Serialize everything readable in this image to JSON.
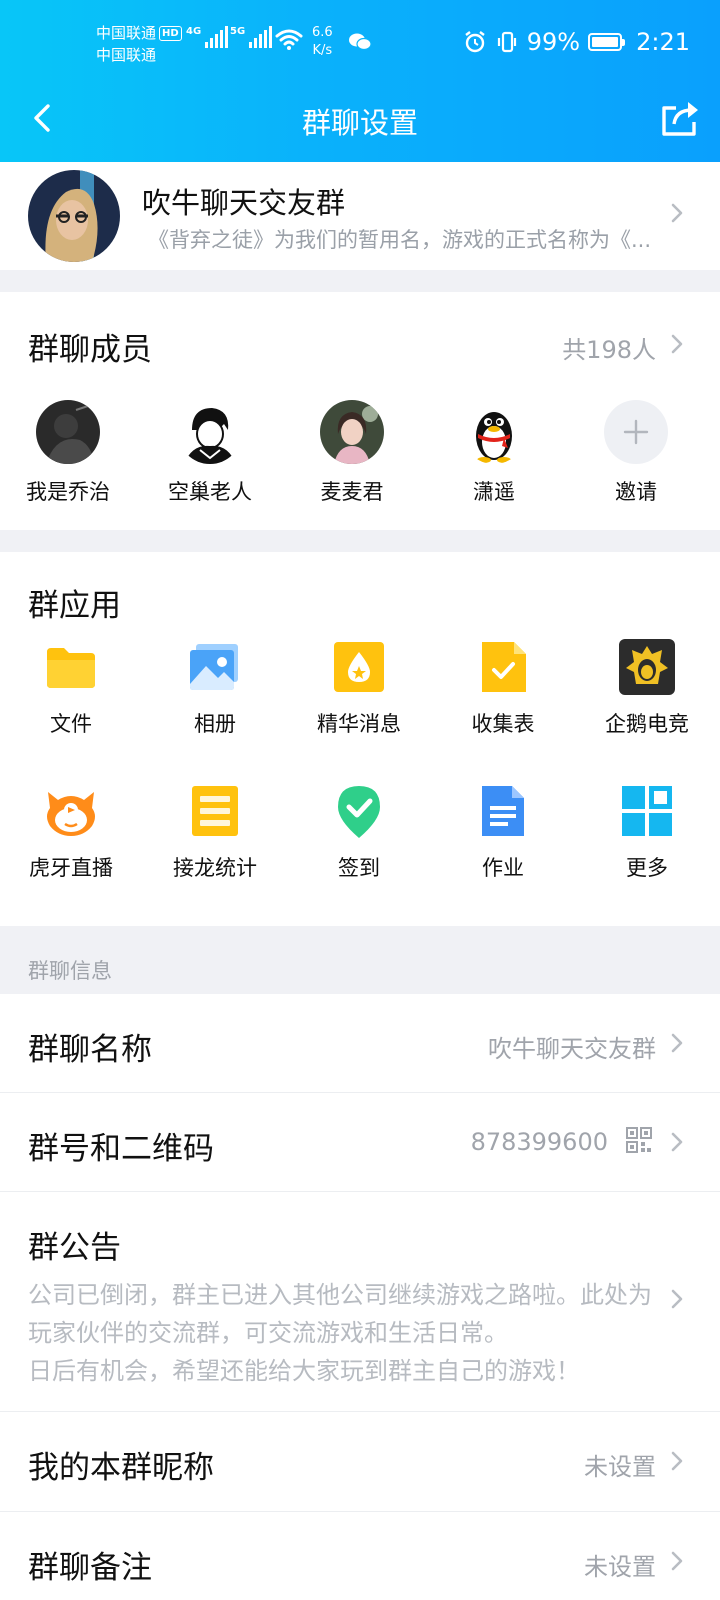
{
  "status_bar": {
    "carrier1": "中国联通",
    "carrier2": "中国联通",
    "hd": "HD",
    "net1": "4G",
    "net2": "5G",
    "speed_value": "6.6",
    "speed_unit": "K/s",
    "battery": "99%",
    "time": "2:21"
  },
  "header": {
    "title": "群聊设置"
  },
  "group": {
    "name": "吹牛聊天交友群",
    "description": "《背弃之徒》为我们的暂用名，游戏的正式名称为《..."
  },
  "members": {
    "title": "群聊成员",
    "count": "共198人",
    "list": [
      {
        "name": "我是乔治"
      },
      {
        "name": "空巢老人"
      },
      {
        "name": "麦麦君"
      },
      {
        "name": "潇遥"
      },
      {
        "name": "邀请"
      }
    ]
  },
  "apps": {
    "title": "群应用",
    "items": [
      {
        "label": "文件",
        "icon": "folder-icon"
      },
      {
        "label": "相册",
        "icon": "album-icon"
      },
      {
        "label": "精华消息",
        "icon": "essence-icon"
      },
      {
        "label": "收集表",
        "icon": "form-icon"
      },
      {
        "label": "企鹅电竞",
        "icon": "esports-icon"
      },
      {
        "label": "虎牙直播",
        "icon": "huya-icon"
      },
      {
        "label": "接龙统计",
        "icon": "list-icon"
      },
      {
        "label": "签到",
        "icon": "checkin-icon"
      },
      {
        "label": "作业",
        "icon": "homework-icon"
      },
      {
        "label": "更多",
        "icon": "more-grid-icon"
      }
    ]
  },
  "info": {
    "section_label": "群聊信息",
    "group_name_label": "群聊名称",
    "group_name_value": "吹牛聊天交友群",
    "group_id_label": "群号和二维码",
    "group_id_value": "878399600",
    "notice_label": "群公告",
    "notice_text": "公司已倒闭，群主已进入其他公司继续游戏之路啦。此处为玩家伙伴的交流群，可交流游戏和生活日常。\n日后有机会，希望还能给大家玩到群主自己的游戏！",
    "nickname_label": "我的本群昵称",
    "nickname_value": "未设置",
    "remark_label": "群聊备注",
    "remark_value": "未设置"
  },
  "colors": {
    "header_gradient_start": "#08c6f8",
    "header_gradient_end": "#0aa0fd",
    "muted_text": "#a0a4ab",
    "page_bg": "#f0f1f5"
  }
}
